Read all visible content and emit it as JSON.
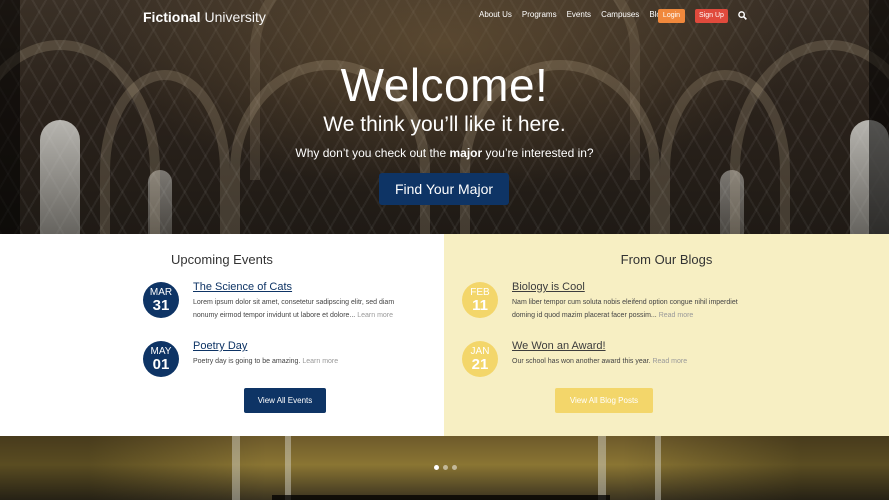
{
  "header": {
    "logo_bold": "Fictional",
    "logo_light": " University",
    "nav": [
      "About Us",
      "Programs",
      "Events",
      "Campuses",
      "Blog"
    ],
    "login_label": "Login",
    "signup_label": "Sign Up",
    "search_icon": "search-icon"
  },
  "hero": {
    "title": "Welcome!",
    "subtitle": "We think you’ll like it here.",
    "question_pre": "Why don’t you check out the ",
    "question_bold": "major",
    "question_post": " you’re interested in?",
    "button_label": "Find Your Major"
  },
  "events": {
    "title": "Upcoming Events",
    "items": [
      {
        "month": "MAR",
        "day": "31",
        "title": "The Science of Cats",
        "text": "Lorem ipsum dolor sit amet, consetetur sadipscing elitr, sed diam nonumy eirmod tempor invidunt ut labore et dolore...",
        "more": "Learn more"
      },
      {
        "month": "MAY",
        "day": "01",
        "title": "Poetry Day",
        "text": "Poetry day is going to be amazing.",
        "more": "Learn more"
      }
    ],
    "button_label": "View All Events"
  },
  "blogs": {
    "title": "From Our Blogs",
    "items": [
      {
        "month": "FEB",
        "day": "11",
        "title": "Biology is Cool",
        "text": "Nam liber tempor cum soluta nobis eleifend option congue nihil imperdiet doming id quod mazim placerat facer possim...",
        "more": "Read more"
      },
      {
        "month": "JAN",
        "day": "21",
        "title": "We Won an Award!",
        "text": "Our school has won another award this year.",
        "more": "Read more"
      }
    ],
    "button_label": "View All Blog Posts"
  },
  "slider": {
    "dot_count": 3,
    "active_dot": 0
  },
  "colors": {
    "primary": "#0e3465",
    "login": "#f0883c",
    "signup": "#e04a3c",
    "blog_bg": "#f7efc3",
    "blog_accent": "#f3d66a"
  }
}
